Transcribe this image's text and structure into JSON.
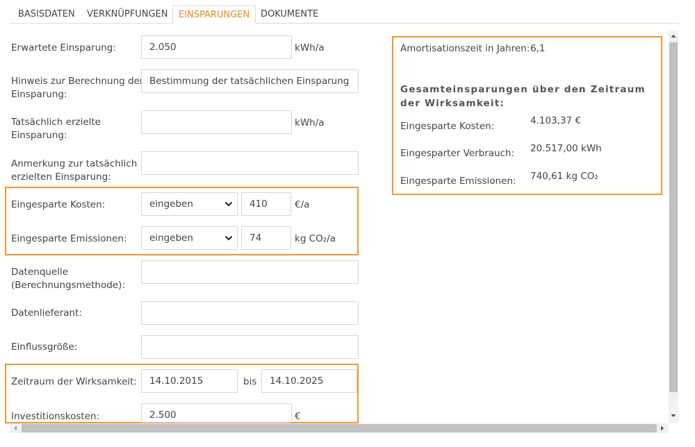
{
  "tabs": [
    {
      "label": "BASISDATEN"
    },
    {
      "label": "VERKNÜPFUNGEN"
    },
    {
      "label": "EINSPARUNGEN"
    },
    {
      "label": "DOKUMENTE"
    }
  ],
  "form": {
    "expected_savings": {
      "label": "Erwartete Einsparung:",
      "value": "2.050",
      "unit": "kWh/a"
    },
    "calc_hint": {
      "label_line1": "Hinweis zur Berechnung der",
      "label_line2": "Einsparung:",
      "value": "Bestimmung der tatsächlichen Einsparung"
    },
    "actual_savings": {
      "label_line1": "Tatsächlich erzielte",
      "label_line2": "Einsparung:",
      "value": "",
      "unit": "kWh/a"
    },
    "actual_note": {
      "label_line1": "Anmerkung zur tatsächlich",
      "label_line2": "erzielten Einsparung:",
      "value": ""
    },
    "saved_costs": {
      "label": "Eingesparte Kosten:",
      "mode": "eingeben",
      "value": "410",
      "unit": "€/a"
    },
    "saved_emissions": {
      "label": "Eingesparte Emissionen:",
      "mode": "eingeben",
      "value": "74",
      "unit": "kg CO₂/a"
    },
    "data_source": {
      "label_line1": "Datenquelle",
      "label_line2": "(Berechnungsmethode):",
      "value": ""
    },
    "data_supplier": {
      "label": "Datenlieferant:",
      "value": ""
    },
    "influence": {
      "label": "Einflussgröße:",
      "value": ""
    },
    "effective_period": {
      "label": "Zeitraum der Wirksamkeit:",
      "from": "14.10.2015",
      "to_label": "bis",
      "to": "14.10.2025"
    },
    "investment": {
      "label": "Investitionskosten:",
      "value": "2.500",
      "unit": "€"
    }
  },
  "summary": {
    "amortization_label": "Amortisationszeit in Jahren:",
    "amortization_value": "6,1",
    "heading": "Gesamteinsparungen über den Zeitraum der Wirksamkeit:",
    "rows": [
      {
        "label": "Eingesparte Kosten:",
        "value": "4.103,37 €"
      },
      {
        "label": "Eingesparter Verbrauch:",
        "value": "20.517,00 kWh"
      },
      {
        "label": "Eingesparte Emissionen:",
        "value": "740,61 kg CO₂"
      }
    ]
  },
  "colors": {
    "accent": "#e58a1f",
    "highlight_border": "#f0962f",
    "input_border": "#d4d4d4"
  },
  "icons": {
    "select_arrow": "chevron-down-icon",
    "scroll_up": "arrow-up-icon",
    "scroll_down": "arrow-down-icon",
    "scroll_left": "arrow-left-icon",
    "scroll_right": "arrow-right-icon"
  }
}
